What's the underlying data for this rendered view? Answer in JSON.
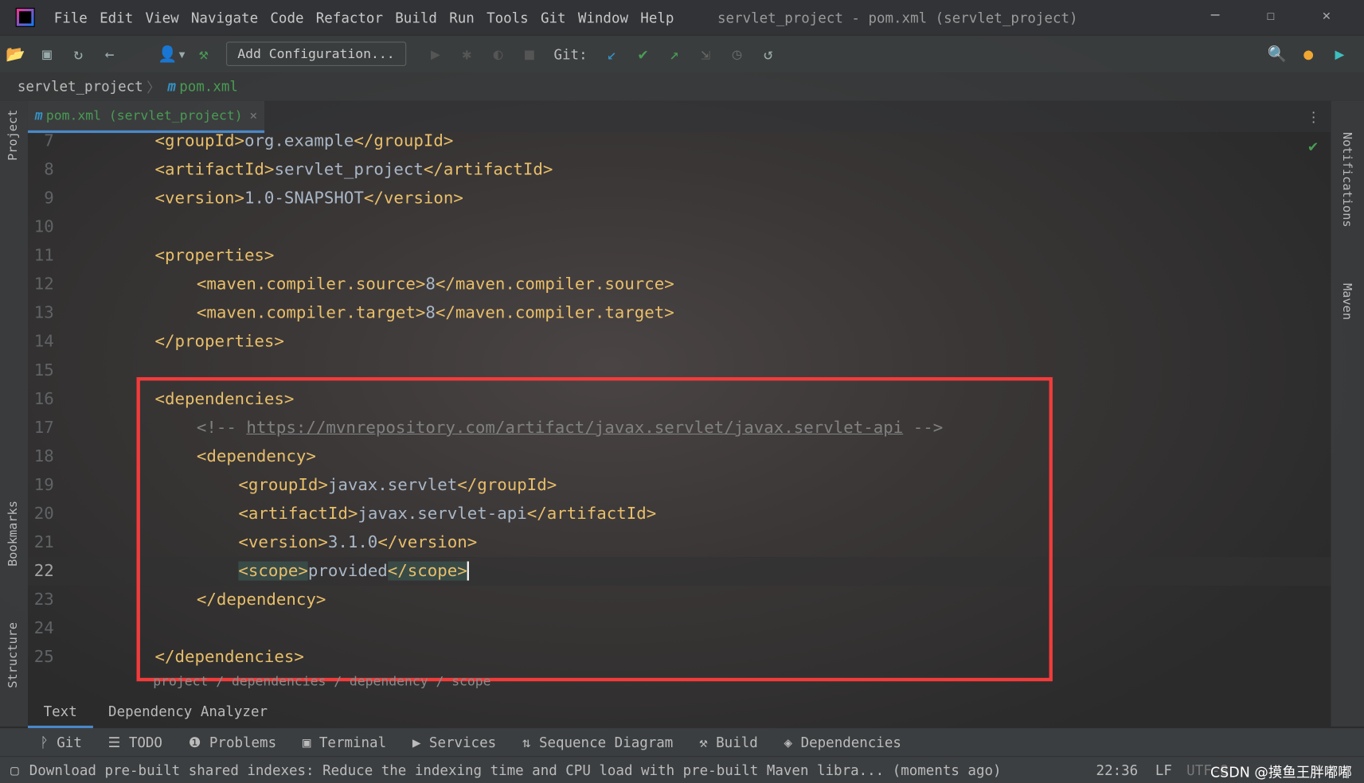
{
  "window": {
    "title": "servlet_project - pom.xml (servlet_project)",
    "logo": "IJ"
  },
  "menu": [
    "File",
    "Edit",
    "View",
    "Navigate",
    "Code",
    "Refactor",
    "Build",
    "Run",
    "Tools",
    "Git",
    "Window",
    "Help"
  ],
  "toolbar": {
    "add_configuration": "Add Configuration...",
    "git_label": "Git:"
  },
  "breadcrumb": {
    "project": "servlet_project",
    "file": "pom.xml",
    "file_icon": "m"
  },
  "tab": {
    "label": "pom.xml (servlet_project)"
  },
  "side": {
    "project": "Project",
    "bookmarks": "Bookmarks",
    "structure": "Structure",
    "notifications": "Notifications",
    "maven": "Maven"
  },
  "editor": {
    "current_line": 22,
    "lines": [
      {
        "n": "7",
        "indent": 0,
        "parts": [
          [
            "t",
            "<groupId>"
          ],
          [
            "",
            "org.example"
          ],
          [
            "t",
            "</groupId>"
          ]
        ]
      },
      {
        "n": "8",
        "indent": 0,
        "parts": [
          [
            "t",
            "<artifactId>"
          ],
          [
            "",
            "servlet_project"
          ],
          [
            "t",
            "</artifactId>"
          ]
        ]
      },
      {
        "n": "9",
        "indent": 0,
        "parts": [
          [
            "t",
            "<version>"
          ],
          [
            "",
            "1.0-SNAPSHOT"
          ],
          [
            "t",
            "</version>"
          ]
        ]
      },
      {
        "n": "10",
        "indent": 0,
        "parts": []
      },
      {
        "n": "11",
        "indent": 0,
        "parts": [
          [
            "t",
            "<properties>"
          ]
        ]
      },
      {
        "n": "12",
        "indent": 1,
        "parts": [
          [
            "t",
            "<maven.compiler.source>"
          ],
          [
            "",
            "8"
          ],
          [
            "t",
            "</maven.compiler.source>"
          ]
        ]
      },
      {
        "n": "13",
        "indent": 1,
        "parts": [
          [
            "t",
            "<maven.compiler.target>"
          ],
          [
            "",
            "8"
          ],
          [
            "t",
            "</maven.compiler.target>"
          ]
        ]
      },
      {
        "n": "14",
        "indent": 0,
        "parts": [
          [
            "t",
            "</properties>"
          ]
        ]
      },
      {
        "n": "15",
        "indent": 0,
        "parts": []
      },
      {
        "n": "16",
        "indent": 0,
        "parts": [
          [
            "t",
            "<dependencies>"
          ]
        ]
      },
      {
        "n": "17",
        "indent": 1,
        "parts": [
          [
            "c",
            "<!-- "
          ],
          [
            "u",
            "https://mvnrepository.com/artifact/javax.servlet/javax.servlet-api"
          ],
          [
            "c",
            " -->"
          ]
        ]
      },
      {
        "n": "18",
        "indent": 1,
        "parts": [
          [
            "t",
            "<dependency>"
          ]
        ]
      },
      {
        "n": "19",
        "indent": 2,
        "parts": [
          [
            "t",
            "<groupId>"
          ],
          [
            "",
            "javax.servlet"
          ],
          [
            "t",
            "</groupId>"
          ]
        ]
      },
      {
        "n": "20",
        "indent": 2,
        "parts": [
          [
            "t",
            "<artifactId>"
          ],
          [
            "",
            "javax.servlet-api"
          ],
          [
            "t",
            "</artifactId>"
          ]
        ]
      },
      {
        "n": "21",
        "indent": 2,
        "parts": [
          [
            "t",
            "<version>"
          ],
          [
            "",
            "3.1.0"
          ],
          [
            "t",
            "</version>"
          ]
        ]
      },
      {
        "n": "22",
        "indent": 2,
        "parts": [
          [
            "t hl",
            "<scope>"
          ],
          [
            "",
            "provided"
          ],
          [
            "t hl",
            "</scope>"
          ]
        ]
      },
      {
        "n": "23",
        "indent": 1,
        "parts": [
          [
            "t",
            "</dependency>"
          ]
        ]
      },
      {
        "n": "24",
        "indent": 0,
        "parts": []
      },
      {
        "n": "25",
        "indent": 0,
        "parts": [
          [
            "t",
            "</dependencies>"
          ]
        ]
      }
    ]
  },
  "path": "project / dependencies / dependency / scope",
  "bottom_tabs": [
    "Text",
    "Dependency Analyzer"
  ],
  "tool_windows": [
    "Git",
    "TODO",
    "Problems",
    "Terminal",
    "Services",
    "Sequence Diagram",
    "Build",
    "Dependencies"
  ],
  "status": {
    "message": "Download pre-built shared indexes: Reduce the indexing time and CPU load with pre-built Maven libra... (moments ago)",
    "time": "22:36",
    "line_sep": "LF",
    "encoding": "UTF-8"
  },
  "watermark": "CSDN @摸鱼王胖嘟嘟",
  "colors": {
    "highlight_box": "#f23b3b",
    "tag": "#e8bf6a",
    "text": "#a9b7c6"
  }
}
